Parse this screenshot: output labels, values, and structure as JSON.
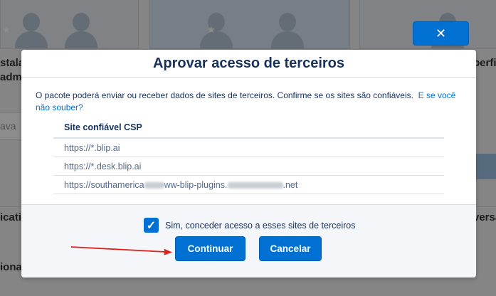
{
  "background": {
    "text_left_1": "stala",
    "text_left_2": "adm",
    "text_right": "perfi",
    "field_left": "ava",
    "text_left_3": "icati",
    "text_right_3": "versa",
    "text_left_4": "iona"
  },
  "close_button": {
    "icon": "close-icon",
    "glyph": "✕"
  },
  "modal": {
    "title": "Aprovar acesso de terceiros",
    "description": "O pacote poderá enviar ou receber dados de sites de terceiros. Confirme se os sites são confiáveis.",
    "description_link": "E se você não souber?",
    "table": {
      "header": "Site confiável CSP",
      "rows": [
        {
          "site": "https://*.blip.ai"
        },
        {
          "site": "https://*.desk.blip.ai"
        },
        {
          "site_prefix": "https://southamerica",
          "site_middle": "ww-blip-plugins.",
          "site_suffix": ".net"
        }
      ]
    },
    "checkbox": {
      "checked": true,
      "label": "Sim, conceder acesso a esses sites de terceiros"
    },
    "buttons": {
      "continue": "Continuar",
      "cancel": "Cancelar"
    }
  },
  "colors": {
    "brand": "#0070d2",
    "annotation_arrow": "#e0201b"
  }
}
